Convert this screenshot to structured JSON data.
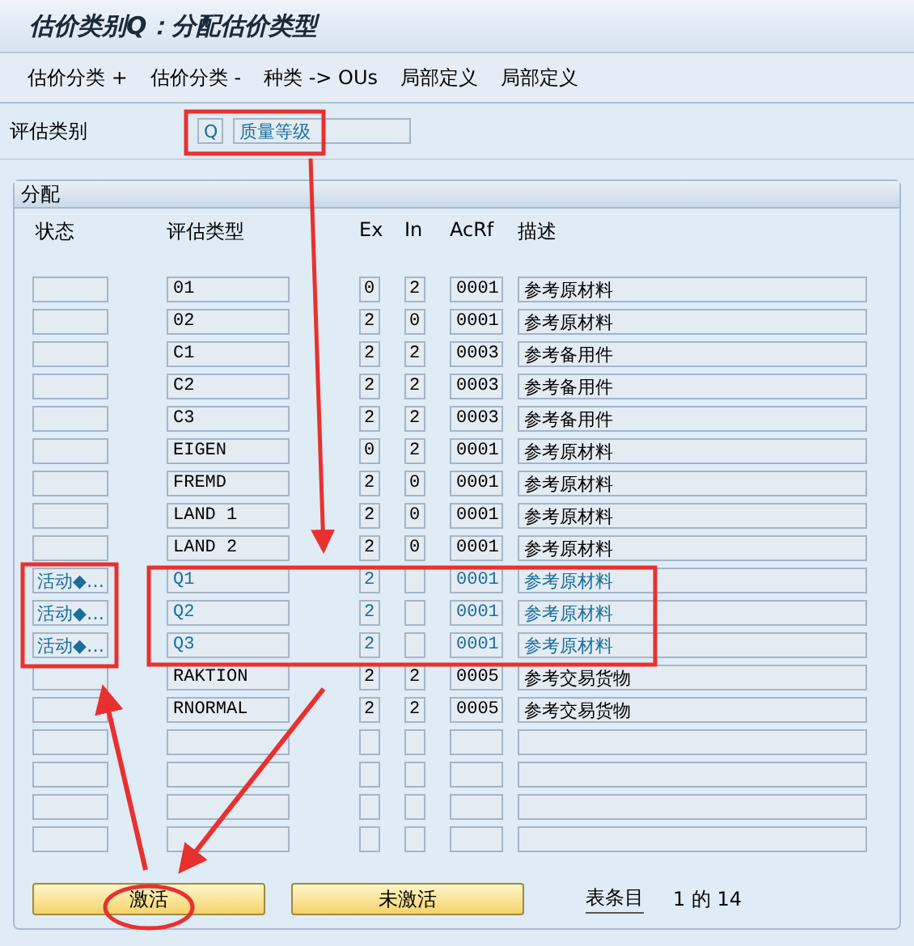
{
  "window": {
    "title": "估价类别Q：分配估价类型"
  },
  "toolbar": [
    "估价分类 +",
    "估价分类 -",
    "种类 -> OUs",
    "局部定义",
    "局部定义"
  ],
  "valuation_category": {
    "label": "评估类别",
    "code": "Q",
    "description": "质量等级"
  },
  "group": {
    "title": "分配",
    "columns": [
      "状态",
      "评估类型",
      "Ex",
      "In",
      "AcRf",
      "描述"
    ],
    "rows": [
      {
        "kind": "filled",
        "active": false,
        "type": "01",
        "ex": "0",
        "in": "2",
        "acrf": "0001",
        "description": "参考原材料"
      },
      {
        "kind": "filled",
        "active": false,
        "type": "02",
        "ex": "2",
        "in": "0",
        "acrf": "0001",
        "description": "参考原材料"
      },
      {
        "kind": "filled",
        "active": false,
        "type": "C1",
        "ex": "2",
        "in": "2",
        "acrf": "0003",
        "description": "参考备用件"
      },
      {
        "kind": "filled",
        "active": false,
        "type": "C2",
        "ex": "2",
        "in": "2",
        "acrf": "0003",
        "description": "参考备用件"
      },
      {
        "kind": "filled",
        "active": false,
        "type": "C3",
        "ex": "2",
        "in": "2",
        "acrf": "0003",
        "description": "参考备用件"
      },
      {
        "kind": "filled",
        "active": false,
        "type": "EIGEN",
        "ex": "0",
        "in": "2",
        "acrf": "0001",
        "description": "参考原材料"
      },
      {
        "kind": "filled",
        "active": false,
        "type": "FREMD",
        "ex": "2",
        "in": "0",
        "acrf": "0001",
        "description": "参考原材料"
      },
      {
        "kind": "filled",
        "active": false,
        "type": "LAND 1",
        "ex": "2",
        "in": "0",
        "acrf": "0001",
        "description": "参考原材料"
      },
      {
        "kind": "filled",
        "active": false,
        "type": "LAND 2",
        "ex": "2",
        "in": "0",
        "acrf": "0001",
        "description": "参考原材料"
      },
      {
        "kind": "filled",
        "active": true,
        "status": "活动◆…",
        "type": "Q1",
        "ex": "2",
        "acrf": "0001",
        "description": "参考原材料"
      },
      {
        "kind": "filled",
        "active": true,
        "status": "活动◆…",
        "type": "Q2",
        "ex": "2",
        "acrf": "0001",
        "description": "参考原材料"
      },
      {
        "kind": "filled",
        "active": true,
        "status": "活动◆…",
        "type": "Q3",
        "ex": "2",
        "acrf": "0001",
        "description": "参考原材料"
      },
      {
        "kind": "filled",
        "active": false,
        "type": "RAKTION",
        "ex": "2",
        "in": "2",
        "acrf": "0005",
        "description": "参考交易货物"
      },
      {
        "kind": "filled",
        "active": false,
        "type": "RNORMAL",
        "ex": "2",
        "in": "2",
        "acrf": "0005",
        "description": "参考交易货物"
      },
      {
        "kind": "empty"
      },
      {
        "kind": "empty"
      },
      {
        "kind": "empty"
      },
      {
        "kind": "empty"
      }
    ],
    "buttons": [
      "激活",
      "未激活"
    ],
    "entry_label": "表条目",
    "entry_count": "1 的 14"
  }
}
